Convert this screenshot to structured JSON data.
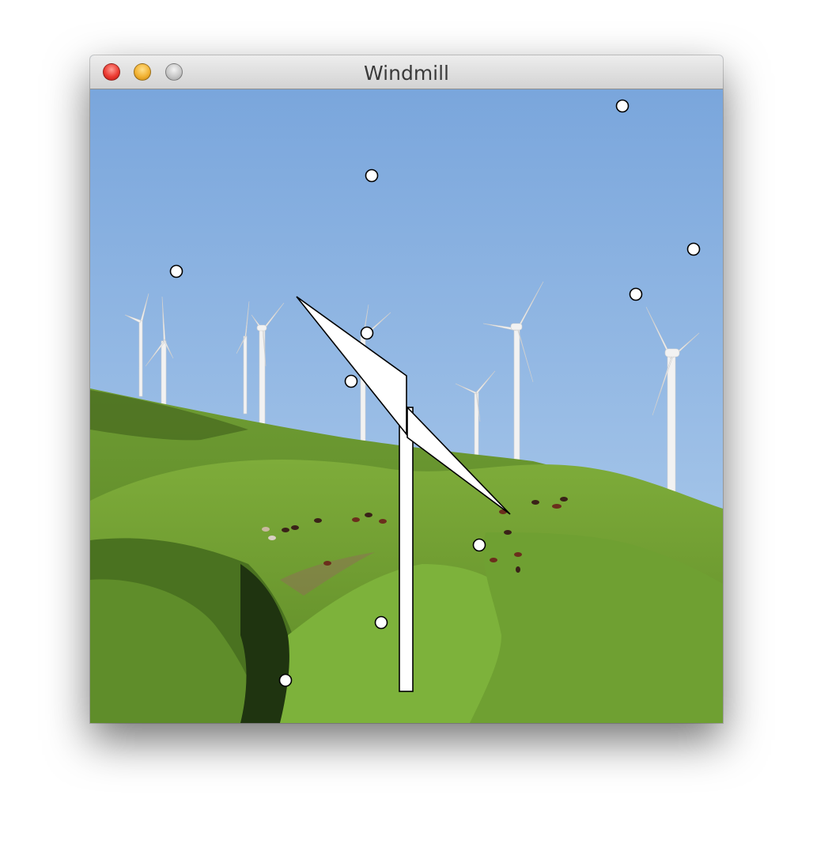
{
  "window": {
    "title": "Windmill"
  },
  "colors": {
    "sky_top": "#7fa9dc",
    "sky_bottom": "#b4d0ed",
    "hill_green": "#6a9a2e",
    "hill_dark": "#2f4a16",
    "turbine_white": "#f4f4f4"
  },
  "icons": {
    "close": "close-button-red",
    "minimize": "minimize-button-yellow",
    "zoom": "zoom-button-gray"
  }
}
